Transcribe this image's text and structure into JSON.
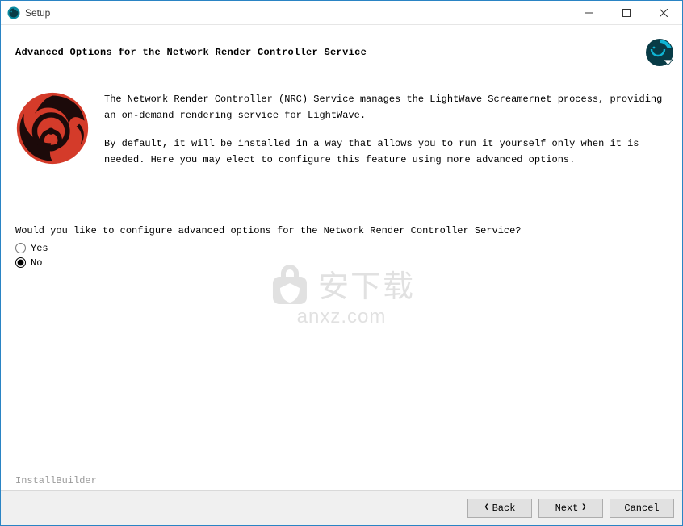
{
  "window": {
    "title": "Setup"
  },
  "header": {
    "title": "Advanced Options for the Network Render Controller Service"
  },
  "intro": {
    "para1": "The Network Render Controller (NRC) Service manages the LightWave Screamernet process, providing an on-demand rendering service for LightWave.",
    "para2": "By default, it will be installed in a way that allows you to run it yourself only when it is needed.  Here you may elect to configure this feature using more advanced options."
  },
  "question": {
    "text": "Would you like to configure advanced options for the Network Render Controller Service?",
    "options": {
      "yes": "Yes",
      "no": "No"
    },
    "selected": "no"
  },
  "watermark": {
    "cn": "安下载",
    "url": "anxz.com"
  },
  "footer": {
    "branding": "InstallBuilder",
    "back": "Back",
    "next": "Next",
    "cancel": "Cancel"
  },
  "colors": {
    "logo_red": "#d43b2a",
    "logo_black": "#1c0a0a",
    "corner_teal": "#0a8aa0",
    "corner_dark": "#083b46"
  }
}
